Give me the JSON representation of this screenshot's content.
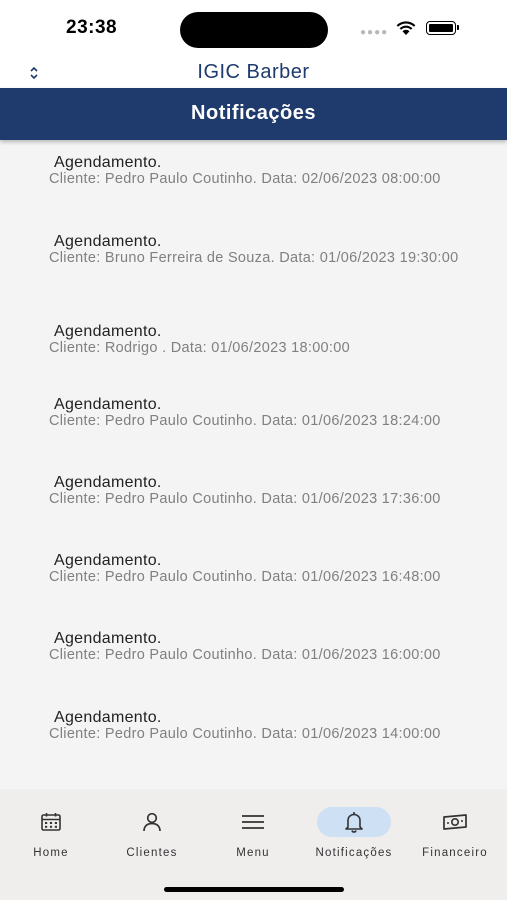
{
  "status_bar": {
    "time": "23:38"
  },
  "app": {
    "title": "IGIC Barber"
  },
  "header": {
    "title": "Notificações"
  },
  "notifications": [
    {
      "title": "Agendamento.",
      "body": "Cliente: Pedro Paulo Coutinho. Data: 02/06/2023 08:00:00"
    },
    {
      "title": "Agendamento.",
      "body": "Cliente: Bruno Ferreira de Souza. Data: 01/06/2023 19:30:00"
    },
    {
      "title": "Agendamento.",
      "body": "Cliente: Rodrigo . Data: 01/06/2023 18:00:00"
    },
    {
      "title": "Agendamento.",
      "body": "Cliente: Pedro Paulo Coutinho. Data: 01/06/2023 18:24:00"
    },
    {
      "title": "Agendamento.",
      "body": "Cliente: Pedro Paulo Coutinho. Data: 01/06/2023 17:36:00"
    },
    {
      "title": "Agendamento.",
      "body": "Cliente: Pedro Paulo Coutinho. Data: 01/06/2023 16:48:00"
    },
    {
      "title": "Agendamento.",
      "body": "Cliente: Pedro Paulo Coutinho. Data: 01/06/2023 16:00:00"
    },
    {
      "title": "Agendamento.",
      "body": "Cliente: Pedro Paulo Coutinho. Data: 01/06/2023 14:00:00"
    }
  ],
  "bottom_nav": [
    {
      "label": "Home",
      "icon": "calendar-icon",
      "active": false
    },
    {
      "label": "Clientes",
      "icon": "person-icon",
      "active": false
    },
    {
      "label": "Menu",
      "icon": "menu-icon",
      "active": false
    },
    {
      "label": "Notificações",
      "icon": "bell-icon",
      "active": true
    },
    {
      "label": "Financeiro",
      "icon": "money-icon",
      "active": false
    }
  ],
  "colors": {
    "header_bg": "#1f3a6d",
    "title": "#1e3a6e",
    "active_pill": "#cde0f4"
  }
}
